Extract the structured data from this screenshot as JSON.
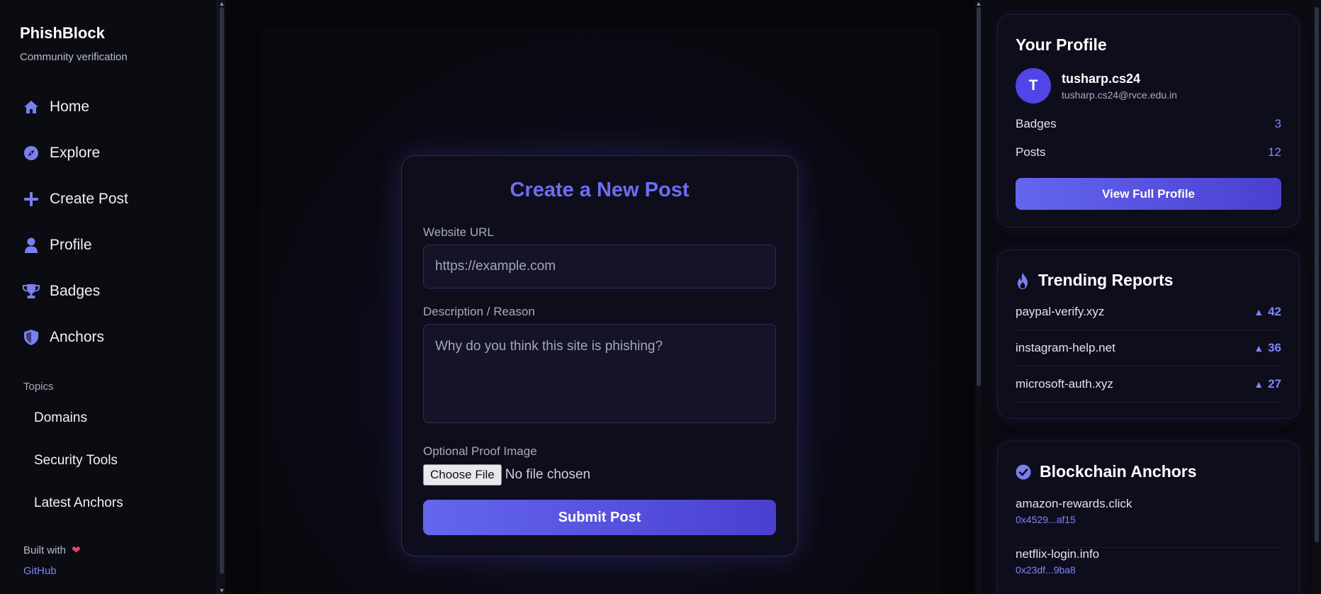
{
  "sidebar": {
    "brand": "PhishBlock",
    "subtitle": "Community verification",
    "nav": [
      {
        "label": "Home",
        "icon": "home-icon"
      },
      {
        "label": "Explore",
        "icon": "compass-icon"
      },
      {
        "label": "Create Post",
        "icon": "plus-icon"
      },
      {
        "label": "Profile",
        "icon": "user-icon"
      },
      {
        "label": "Badges",
        "icon": "trophy-icon"
      },
      {
        "label": "Anchors",
        "icon": "shield-icon"
      }
    ],
    "topics_heading": "Topics",
    "topics": [
      "Domains",
      "Security Tools",
      "Latest Anchors"
    ],
    "built_with": "Built with",
    "github": "GitHub"
  },
  "form": {
    "title": "Create a New Post",
    "url_label": "Website URL",
    "url_placeholder": "https://example.com",
    "url_value": "",
    "desc_label": "Description / Reason",
    "desc_placeholder": "Why do you think this site is phishing?",
    "desc_value": "",
    "image_label": "Optional Proof Image",
    "file_button": "Choose File",
    "file_status": "No file chosen",
    "submit": "Submit Post"
  },
  "profile": {
    "title": "Your Profile",
    "avatar_letter": "T",
    "name": "tusharp.cs24",
    "email": "tusharp.cs24@rvce.edu.in",
    "stats": [
      {
        "label": "Badges",
        "value": "3"
      },
      {
        "label": "Posts",
        "value": "12"
      }
    ],
    "button": "View Full Profile"
  },
  "trending": {
    "title": "Trending Reports",
    "items": [
      {
        "domain": "paypal-verify.xyz",
        "votes": "42"
      },
      {
        "domain": "instagram-help.net",
        "votes": "36"
      },
      {
        "domain": "microsoft-auth.xyz",
        "votes": "27"
      }
    ]
  },
  "anchors": {
    "title": "Blockchain Anchors",
    "items": [
      {
        "domain": "amazon-rewards.click",
        "hash": "0x4529...af15"
      },
      {
        "domain": "netflix-login.info",
        "hash": "0x23df...9ba8"
      }
    ]
  },
  "colors": {
    "accent": "#6d6df2",
    "accent_link": "#7d86ff",
    "avatar": "#4f46e5",
    "heart": "#f0416c"
  }
}
